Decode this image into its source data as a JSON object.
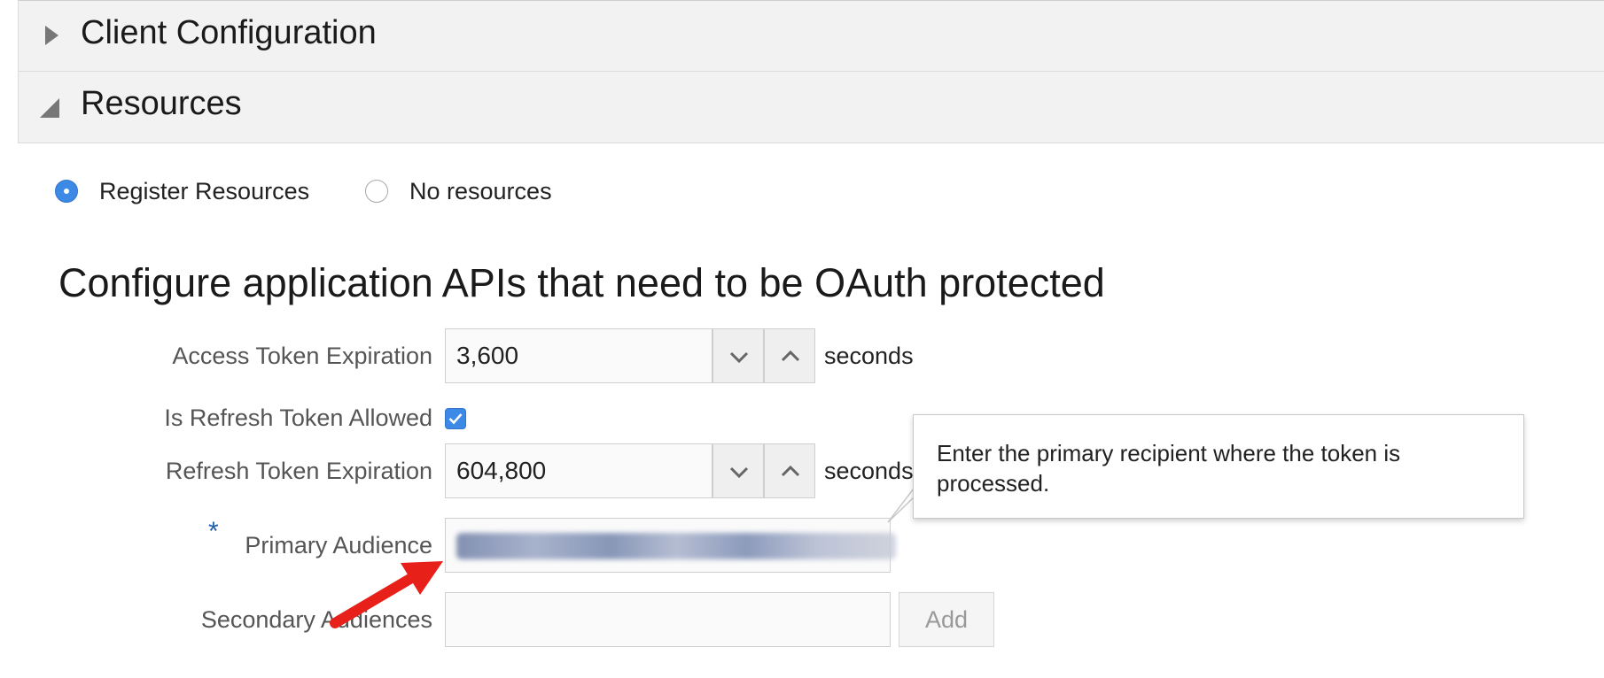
{
  "accordion": {
    "client_config_title": "Client Configuration",
    "resources_title": "Resources"
  },
  "resources_mode": {
    "options": [
      {
        "label": "Register Resources",
        "checked": true
      },
      {
        "label": "No resources",
        "checked": false
      }
    ]
  },
  "section_heading": "Configure application APIs that need to be OAuth protected",
  "form": {
    "access_token_expiration": {
      "label": "Access Token Expiration",
      "value": "3,600",
      "unit": "seconds"
    },
    "refresh_token_allowed": {
      "label": "Is Refresh Token Allowed",
      "checked": true
    },
    "refresh_token_expiration": {
      "label": "Refresh Token Expiration",
      "value": "604,800",
      "unit": "seconds"
    },
    "primary_audience": {
      "required_marker": "*",
      "label": "Primary Audience"
    },
    "secondary_audiences": {
      "label": "Secondary Audiences",
      "value": "",
      "add_label": "Add"
    }
  },
  "tooltip": {
    "text": "Enter the primary recipient where the token is processed."
  },
  "colors": {
    "accent": "#3d8ae6",
    "header_bg": "#f2f2f2",
    "arrow": "#e8201a",
    "required": "#1f5fa8"
  },
  "icons": {
    "expand": "triangle-right-icon",
    "collapse": "triangle-collapse-icon",
    "decrement": "chevron-down-icon",
    "increment": "chevron-up-icon",
    "checkbox": "checkmark-icon",
    "annotation": "red-arrow-icon"
  }
}
